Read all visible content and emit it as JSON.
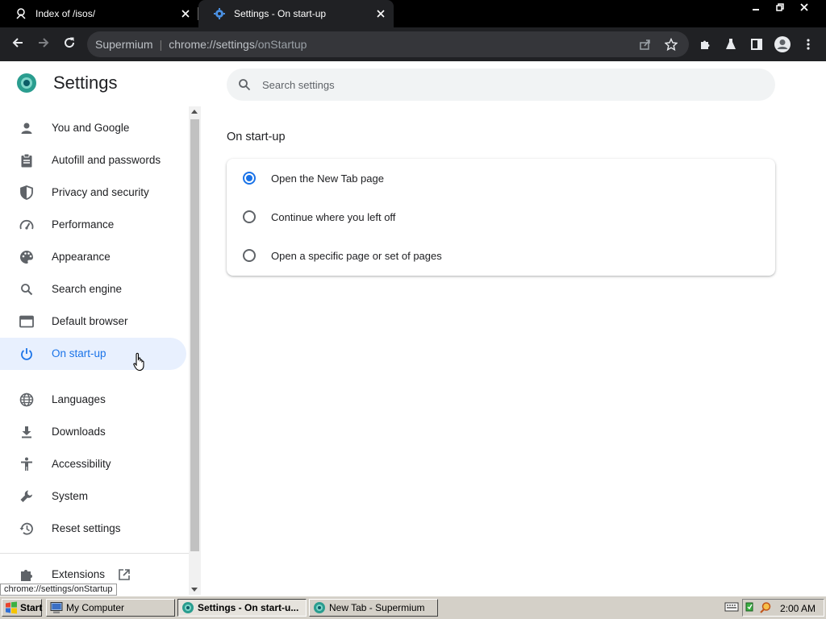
{
  "browser": {
    "tabs": [
      {
        "title": "Index of /isos/",
        "icon": "page-icon",
        "active": false
      },
      {
        "title": "Settings - On start-up",
        "icon": "gear-icon",
        "active": true
      }
    ],
    "window_controls": [
      "minimize",
      "restore",
      "close"
    ],
    "omnibox": {
      "site_name": "Supermium",
      "url_host": "chrome://settings",
      "url_path": "/onStartup"
    }
  },
  "settings": {
    "title": "Settings",
    "search_placeholder": "Search settings",
    "sidebar": {
      "items": [
        {
          "label": "You and Google",
          "icon": "person-icon"
        },
        {
          "label": "Autofill and passwords",
          "icon": "clipboard-icon"
        },
        {
          "label": "Privacy and security",
          "icon": "shield-icon"
        },
        {
          "label": "Performance",
          "icon": "speedometer-icon"
        },
        {
          "label": "Appearance",
          "icon": "palette-icon"
        },
        {
          "label": "Search engine",
          "icon": "search-icon"
        },
        {
          "label": "Default browser",
          "icon": "browser-window-icon"
        },
        {
          "label": "On start-up",
          "icon": "power-icon",
          "selected": true
        },
        {
          "label": "Languages",
          "icon": "globe-icon"
        },
        {
          "label": "Downloads",
          "icon": "download-icon"
        },
        {
          "label": "Accessibility",
          "icon": "accessibility-icon"
        },
        {
          "label": "System",
          "icon": "wrench-icon"
        },
        {
          "label": "Reset settings",
          "icon": "history-icon"
        },
        {
          "label": "Extensions",
          "icon": "puzzle-icon",
          "external": true
        }
      ]
    },
    "startup": {
      "section_title": "On start-up",
      "options": [
        {
          "label": "Open the New Tab page",
          "checked": true
        },
        {
          "label": "Continue where you left off",
          "checked": false
        },
        {
          "label": "Open a specific page or set of pages",
          "checked": false
        }
      ]
    }
  },
  "status_bubble": "chrome://settings/onStartup",
  "taskbar": {
    "start_label": "Start",
    "buttons": [
      {
        "label": "My Computer",
        "pressed": false
      },
      {
        "label": "Settings - On start-u...",
        "pressed": true
      },
      {
        "label": "New Tab - Supermium",
        "pressed": false
      }
    ],
    "clock": "2:00 AM"
  },
  "colors": {
    "accent": "#1a73e8",
    "selected_bg": "#e8f0fe",
    "toolbar_bg": "#202124",
    "omnibox_bg": "#35363a",
    "taskbar_bg": "#d4d0c8"
  }
}
